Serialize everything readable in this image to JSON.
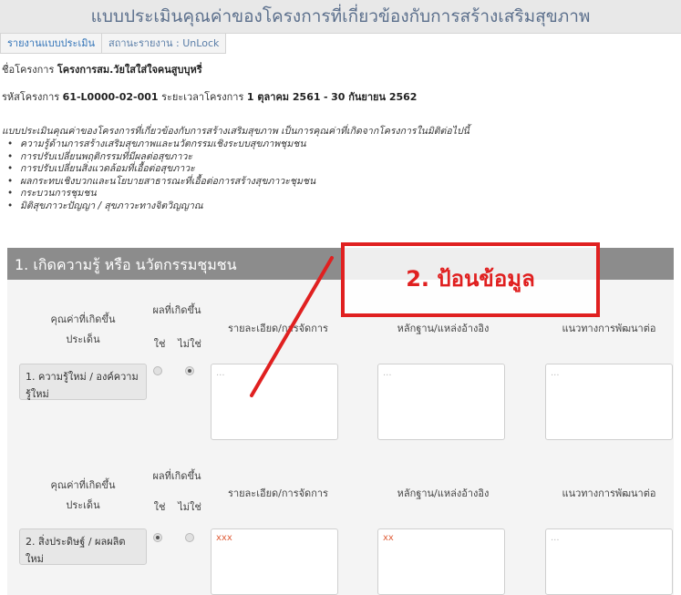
{
  "header": {
    "title": "แบบประเมินคุณค่าของโครงการที่เกี่ยวข้องกับการสร้างเสริมสุขภาพ"
  },
  "tabs": [
    {
      "label": "รายงานแบบประเมิน"
    },
    {
      "label": "สถานะรายงาน : UnLock"
    }
  ],
  "project": {
    "name_label": "ชื่อโครงการ",
    "name": "โครงการสม.วัยใสใส่ใจคนสูบบุหรี่",
    "code_label": "รหัสโครงการ",
    "code": "61-L0000-02-001",
    "period_label": "ระยะเวลาโครงการ",
    "start": "1 ตุลาคม 2561",
    "dash": "-",
    "end": "30 กันยายน 2562"
  },
  "description": "แบบประเมินคุณค่าของโครงการที่เกี่ยวข้องกับการสร้างเสริมสุขภาพ เป็นการคุณค่าที่เกิดจากโครงการในมิติต่อไปนี้",
  "bullets": [
    "ความรู้ด้านการสร้างเสริมสุขภาพและนวัตกรรมเชิงระบบสุขภาพชุมชน",
    "การปรับเปลี่ยนพฤติกรรมที่มีผลต่อสุขภาวะ",
    "การปรับเปลี่ยนสิ่งแวดล้อมที่เอื้อต่อสุขภาวะ",
    "ผลกระทบเชิงบวกและนโยบายสาธารณะที่เอื้อต่อการสร้างสุขภาวะชุมชน",
    "กระบวนการชุมชน",
    "มิติสุขภาวะปัญญา / สุขภาวะทางจิตวิญญาณ"
  ],
  "section": {
    "title": "1. เกิดความรู้ หรือ นวัตกรรมชุมชน"
  },
  "table_header": {
    "col1_line1": "คุณค่าที่เกิดขึ้น",
    "col1_line2": "ประเด็น",
    "result": "ผลที่เกิดขึ้น",
    "yes": "ใช่",
    "no": "ไม่ใช่",
    "detail": "รายละเอียด/การจัดการ",
    "evidence": "หลักฐาน/แหล่งอ้างอิง",
    "next": "แนวทางการพัฒนาต่อ"
  },
  "rows": [
    {
      "label": "1. ความรู้ใหม่ / องค์ความรู้ใหม่",
      "selected": "no",
      "detail": "...",
      "evidence": "...",
      "next": "..."
    },
    {
      "label": "2. สิ่งประดิษฐ์ / ผลผลิตใหม่",
      "selected": "yes",
      "detail": "xxx",
      "evidence": "xx",
      "next": "..."
    }
  ],
  "annotation": {
    "text": "2. ป้อนข้อมูล",
    "color": "#e02020"
  }
}
